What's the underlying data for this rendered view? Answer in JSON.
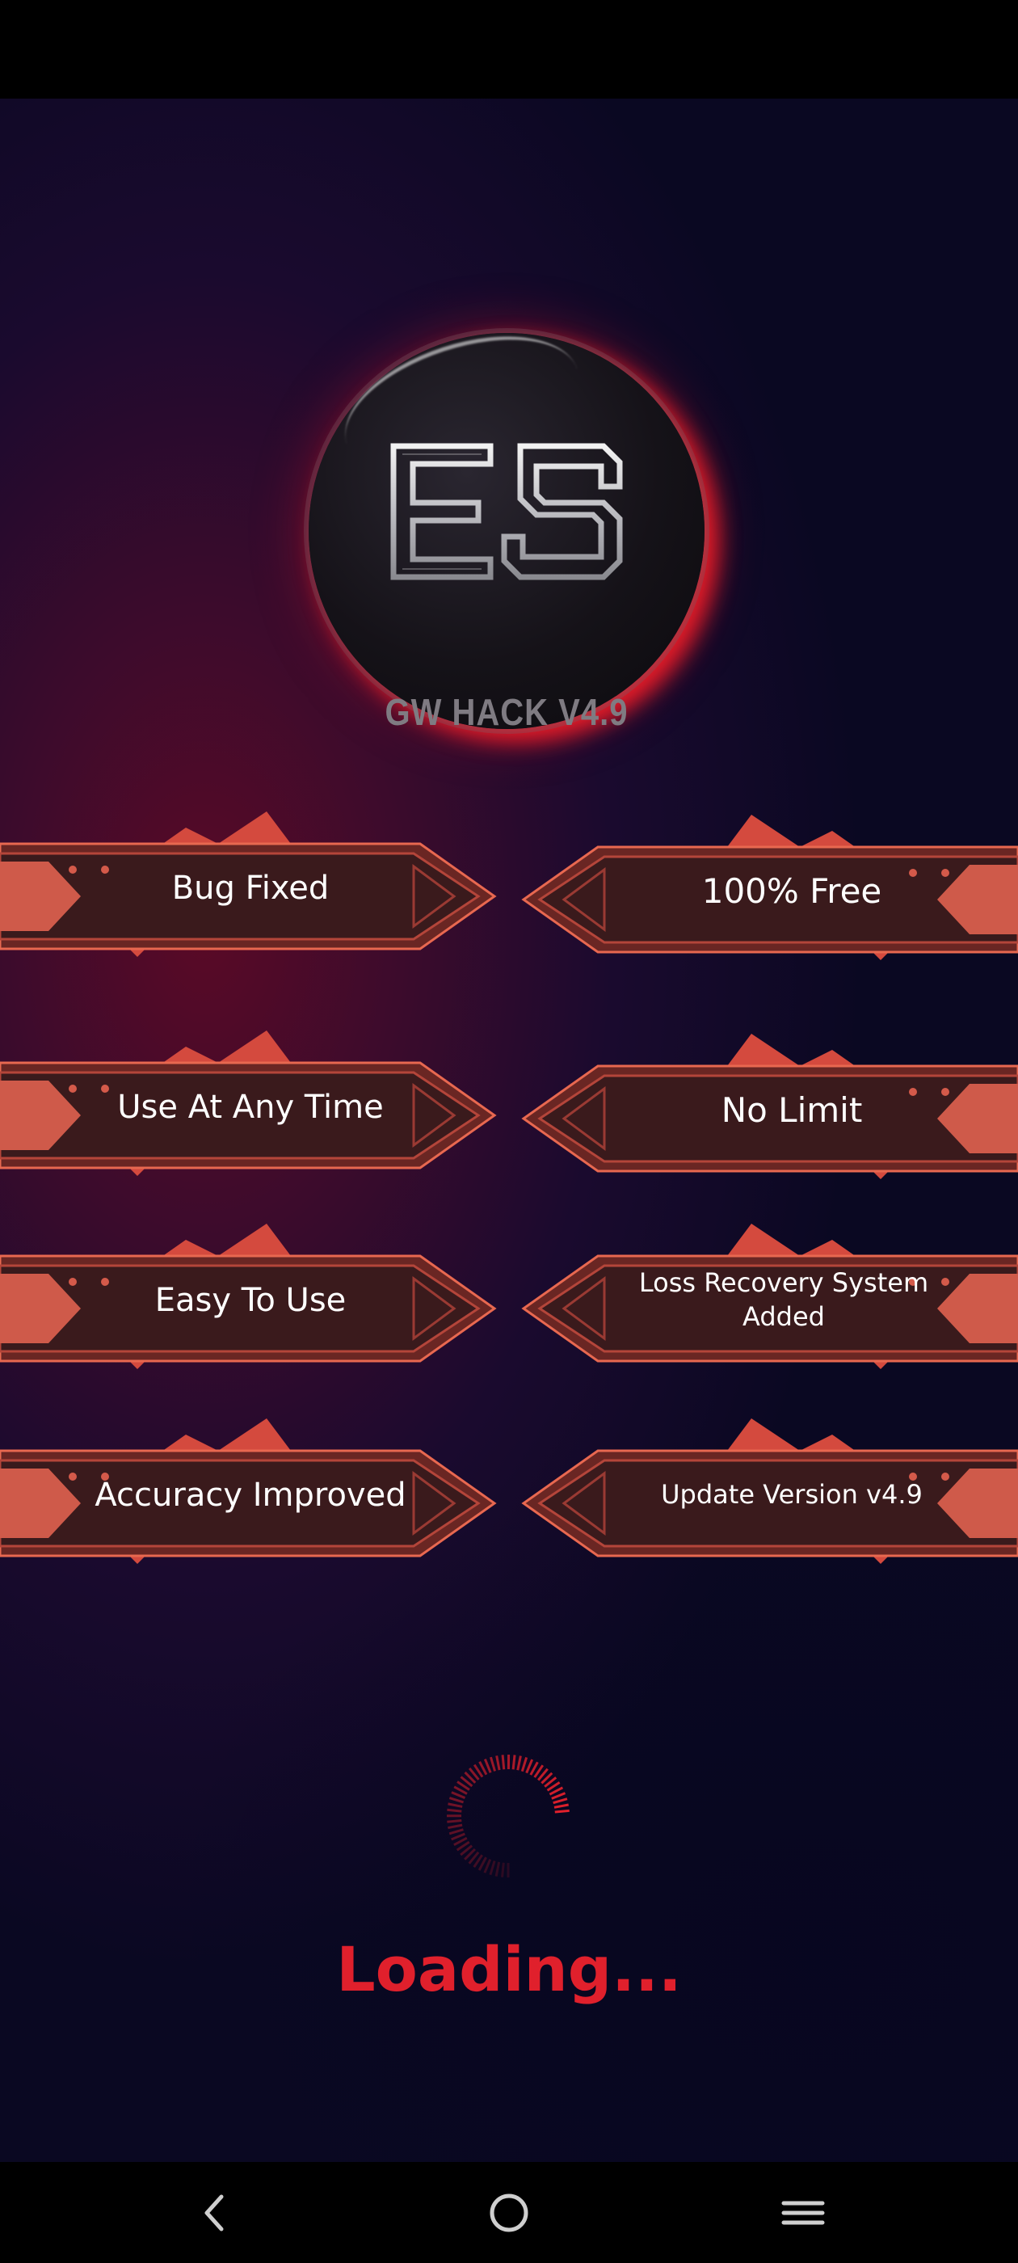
{
  "logo": {
    "monogram": "ES",
    "subtitle": "GW HACK V4.9"
  },
  "features": {
    "left": [
      {
        "label": "Bug Fixed"
      },
      {
        "label": "Use At Any Time"
      },
      {
        "label": "Easy To Use"
      },
      {
        "label": "Accuracy Improved"
      }
    ],
    "right": [
      {
        "label": "100% Free"
      },
      {
        "label": "No Limit"
      },
      {
        "label": "Loss Recovery System Added"
      },
      {
        "label": "Update Version v4.9"
      }
    ]
  },
  "loading": {
    "text": "Loading..."
  },
  "navigation": {
    "back_icon": "back-icon",
    "home_icon": "home-icon",
    "recents_icon": "recents-icon"
  },
  "colors": {
    "accent": "#e0202c",
    "banner_red": "#c8483f"
  }
}
